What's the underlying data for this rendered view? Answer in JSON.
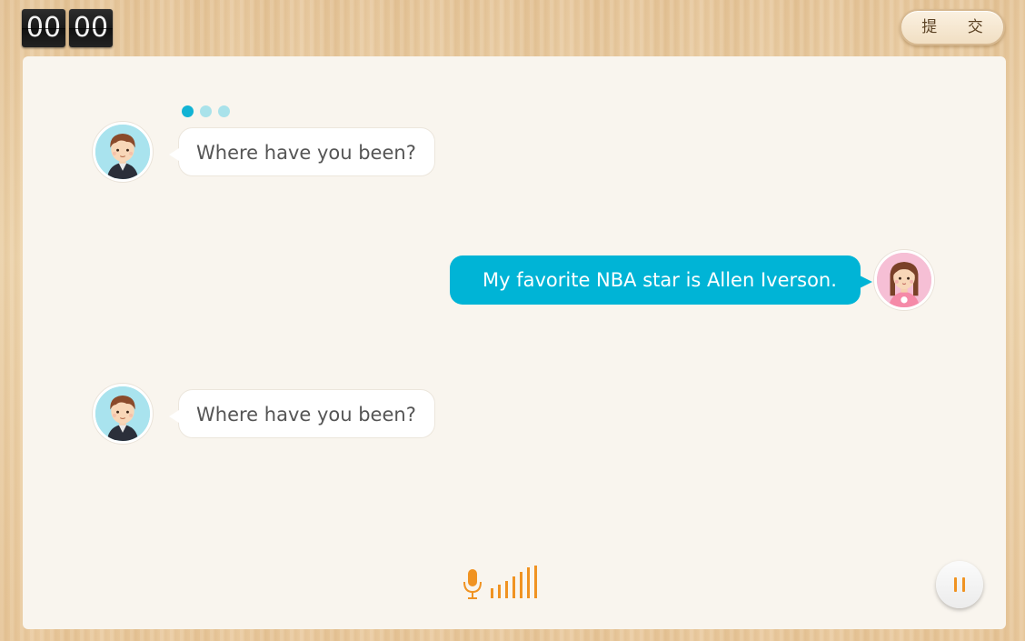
{
  "timer": {
    "minutes": "00",
    "seconds": "00"
  },
  "submit": {
    "label": "提 交"
  },
  "progress_dots": {
    "total": 3,
    "active_index": 0
  },
  "conversation": [
    {
      "speaker": "boy",
      "side": "left",
      "text": "Where have you been?"
    },
    {
      "speaker": "girl",
      "side": "right",
      "text": "My favorite NBA star is Allen Iverson."
    },
    {
      "speaker": "boy",
      "side": "left",
      "text": "Where have you been?"
    }
  ],
  "colors": {
    "accent": "#00b4d6",
    "recorder": "#f09322",
    "panel": "#f9f5ee"
  },
  "icons": {
    "recorder": "microphone-icon",
    "volume": "volume-level-icon",
    "pause": "pause-icon"
  }
}
